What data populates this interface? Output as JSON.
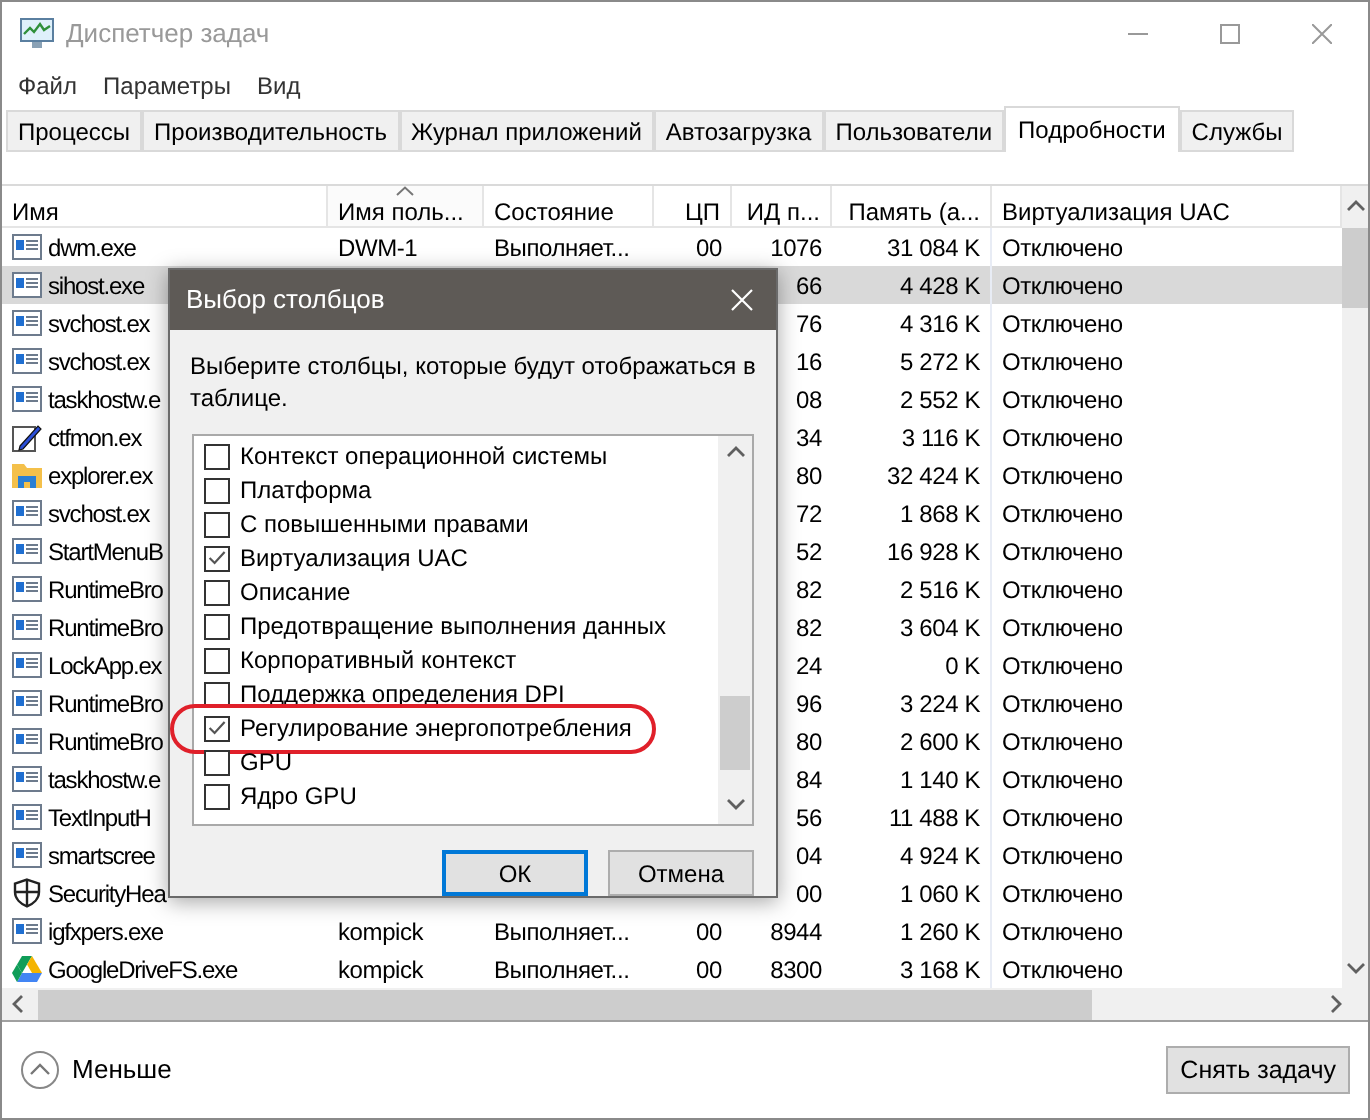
{
  "window": {
    "title": "Диспетчер задач"
  },
  "menu": [
    "Файл",
    "Параметры",
    "Вид"
  ],
  "tabs": [
    {
      "label": "Процессы",
      "selected": false
    },
    {
      "label": "Производительность",
      "selected": false
    },
    {
      "label": "Журнал приложений",
      "selected": false
    },
    {
      "label": "Автозагрузка",
      "selected": false
    },
    {
      "label": "Пользователи",
      "selected": false
    },
    {
      "label": "Подробности",
      "selected": true
    },
    {
      "label": "Службы",
      "selected": false
    }
  ],
  "table": {
    "columns": [
      {
        "label": "Имя",
        "sorted": false
      },
      {
        "label": "Имя поль...",
        "sorted": true
      },
      {
        "label": "Состояние",
        "sorted": false
      },
      {
        "label": "ЦП",
        "sorted": false
      },
      {
        "label": "ИД п...",
        "sorted": false
      },
      {
        "label": "Память (а...",
        "sorted": false
      },
      {
        "label": "Виртуализация UAC",
        "sorted": false
      }
    ],
    "rows": [
      {
        "kind": "app",
        "selected": false,
        "cells": [
          "dwm.exe",
          "DWM-1",
          "Выполняет...",
          "00",
          "1076",
          "31 084 K",
          "Отключено"
        ]
      },
      {
        "kind": "app",
        "selected": true,
        "cells": [
          "sihost.exe",
          "",
          "",
          "",
          "66",
          "4 428 K",
          "Отключено"
        ]
      },
      {
        "kind": "app",
        "selected": false,
        "cells": [
          "svchost.ex",
          "",
          "",
          "",
          "76",
          "4 316 K",
          "Отключено"
        ]
      },
      {
        "kind": "app",
        "selected": false,
        "cells": [
          "svchost.ex",
          "",
          "",
          "",
          "16",
          "5 272 K",
          "Отключено"
        ]
      },
      {
        "kind": "app",
        "selected": false,
        "cells": [
          "taskhostw.e",
          "",
          "",
          "",
          "08",
          "2 552 K",
          "Отключено"
        ]
      },
      {
        "kind": "pen",
        "selected": false,
        "cells": [
          "ctfmon.ex",
          "",
          "",
          "",
          "34",
          "3 116 K",
          "Отключено"
        ]
      },
      {
        "kind": "folder",
        "selected": false,
        "cells": [
          "explorer.ex",
          "",
          "",
          "",
          "80",
          "32 424 K",
          "Отключено"
        ]
      },
      {
        "kind": "app",
        "selected": false,
        "cells": [
          "svchost.ex",
          "",
          "",
          "",
          "72",
          "1 868 K",
          "Отключено"
        ]
      },
      {
        "kind": "app",
        "selected": false,
        "cells": [
          "StartMenuB",
          "",
          "",
          "",
          "52",
          "16 928 K",
          "Отключено"
        ]
      },
      {
        "kind": "app",
        "selected": false,
        "cells": [
          "RuntimeBro",
          "",
          "",
          "",
          "82",
          "2 516 K",
          "Отключено"
        ]
      },
      {
        "kind": "app",
        "selected": false,
        "cells": [
          "RuntimeBro",
          "",
          "",
          "",
          "82",
          "3 604 K",
          "Отключено"
        ]
      },
      {
        "kind": "app",
        "selected": false,
        "cells": [
          "LockApp.ex",
          "",
          "",
          "",
          "24",
          "0 K",
          "Отключено"
        ]
      },
      {
        "kind": "app",
        "selected": false,
        "cells": [
          "RuntimeBro",
          "",
          "",
          "",
          "96",
          "3 224 K",
          "Отключено"
        ]
      },
      {
        "kind": "app",
        "selected": false,
        "cells": [
          "RuntimeBro",
          "",
          "",
          "",
          "80",
          "2 600 K",
          "Отключено"
        ]
      },
      {
        "kind": "app",
        "selected": false,
        "cells": [
          "taskhostw.e",
          "",
          "",
          "",
          "84",
          "1 140 K",
          "Отключено"
        ]
      },
      {
        "kind": "app",
        "selected": false,
        "cells": [
          "TextInputH",
          "",
          "",
          "",
          "56",
          "11 488 K",
          "Отключено"
        ]
      },
      {
        "kind": "app",
        "selected": false,
        "cells": [
          "smartscree",
          "",
          "",
          "",
          "04",
          "4 924 K",
          "Отключено"
        ]
      },
      {
        "kind": "shield",
        "selected": false,
        "cells": [
          "SecurityHea",
          "",
          "",
          "",
          "00",
          "1 060 K",
          "Отключено"
        ]
      },
      {
        "kind": "app",
        "selected": false,
        "cells": [
          "igfxpers.exe",
          "kompick",
          "Выполняет...",
          "00",
          "8944",
          "1 260 K",
          "Отключено"
        ]
      },
      {
        "kind": "drive",
        "selected": false,
        "cells": [
          "GoogleDriveFS.exe",
          "kompick",
          "Выполняет...",
          "00",
          "8300",
          "3 168 K",
          "Отключено"
        ]
      }
    ]
  },
  "dialog": {
    "title": "Выбор столбцов",
    "instruction": "Выберите столбцы, которые будут отображаться в таблице.",
    "options": [
      {
        "label": "Контекст операционной системы",
        "checked": false,
        "highlighted": false
      },
      {
        "label": "Платформа",
        "checked": false,
        "highlighted": false
      },
      {
        "label": "С повышенными правами",
        "checked": false,
        "highlighted": false
      },
      {
        "label": "Виртуализация UAC",
        "checked": true,
        "highlighted": false
      },
      {
        "label": "Описание",
        "checked": false,
        "highlighted": false
      },
      {
        "label": "Предотвращение выполнения данных",
        "checked": false,
        "highlighted": false
      },
      {
        "label": "Корпоративный контекст",
        "checked": false,
        "highlighted": false
      },
      {
        "label": "Поддержка определения DPI",
        "checked": false,
        "highlighted": false
      },
      {
        "label": "Регулирование энергопотребления",
        "checked": true,
        "highlighted": true
      },
      {
        "label": "GPU",
        "checked": false,
        "highlighted": false
      },
      {
        "label": "Ядро GPU",
        "checked": false,
        "highlighted": false
      }
    ],
    "buttons": [
      {
        "label": "ОК",
        "focused": true
      },
      {
        "label": "Отмена",
        "focused": false
      }
    ]
  },
  "footer": {
    "toggle": "Меньше",
    "end_task": "Снять задачу"
  }
}
